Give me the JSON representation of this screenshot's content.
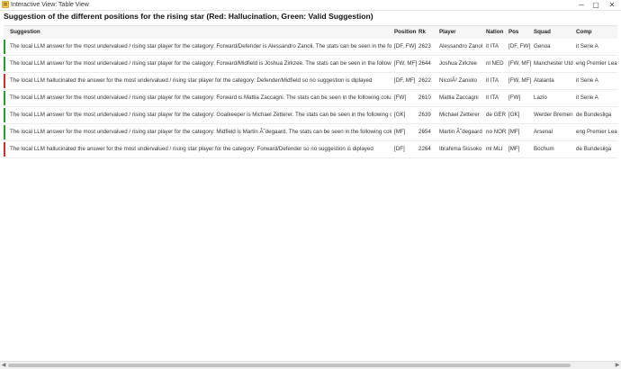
{
  "window": {
    "title": "Interactive View: Table View",
    "controls": {
      "minimize": "─",
      "maximize": "▢",
      "close": "✕"
    }
  },
  "heading": "Suggestion of the different positions for the rising star (Red: Hallucination, Green: Valid Suggestion)",
  "colors": {
    "valid": "#2a9d2a",
    "hallucination": "#d32f2f",
    "header_bg": "#f6f6f6"
  },
  "table": {
    "columns": [
      "Suggestion",
      "Position",
      "Rk",
      "Player",
      "Nation",
      "Pos",
      "Squad",
      "Comp"
    ],
    "rows": [
      {
        "status": "valid",
        "suggestion": "The local LLM answer for the most undervalued / rising star player for the category: Forward/Defender is Alessandro Zanoli. The stats can be seen in the following",
        "position": "[DF, FW]",
        "rk": "2623",
        "player": "Alessandro Zanoli",
        "nation": "it ITA",
        "pos": "[DF, FW]",
        "squad": "Genoa",
        "comp": "it Serie A"
      },
      {
        "status": "valid",
        "suggestion": "The local LLM answer for the most undervalued / rising star player for the category: Forward/Midfield is Joshua Zirkzee. The stats can be seen in the following co",
        "position": "[FW, MF]",
        "rk": "2644",
        "player": "Joshua Zirkzee",
        "nation": "nl NED",
        "pos": "[FW, MF]",
        "squad": "Manchester Utd",
        "comp": "eng Premier League"
      },
      {
        "status": "hallucination",
        "suggestion": "The local LLM hallucinated the answer for the most undervalued / rising star player for the category: Defender/Midfield so no suggestion is diplayed",
        "position": "[DF, MF]",
        "rk": "2622",
        "player": "NicolÃ² Zaniolo",
        "nation": "it ITA",
        "pos": "[FW, MF]",
        "squad": "Atalanta",
        "comp": "it Serie A"
      },
      {
        "status": "valid",
        "suggestion": "The local LLM answer for the most undervalued / rising star player for the category: Forward is Mattia Zaccagni. The stats can be seen in the following columns",
        "position": "[FW]",
        "rk": "2610",
        "player": "Mattia Zaccagni",
        "nation": "it ITA",
        "pos": "[FW]",
        "squad": "Lazio",
        "comp": "it Serie A"
      },
      {
        "status": "valid",
        "suggestion": "The local LLM answer for the most undervalued / rising star player for the category: Goalkeeper is Michael Zetterer. The stats can be seen in the following columns",
        "position": "[GK]",
        "rk": "2639",
        "player": "Michael Zetterer",
        "nation": "de GER",
        "pos": "[GK]",
        "squad": "Werder Bremen",
        "comp": "de Bundesliga"
      },
      {
        "status": "valid",
        "suggestion": "The local LLM answer for the most undervalued / rising star player for the category: Midfield is Martin Ã˜degaard. The stats can be seen in the following colum",
        "position": "[MF]",
        "rk": "2654",
        "player": "Martin Ã˜degaard",
        "nation": "no NOR",
        "pos": "[MF]",
        "squad": "Arsenal",
        "comp": "eng Premier League"
      },
      {
        "status": "hallucination",
        "suggestion": "The local LLM hallucinated the answer for the most undervalued / rising star player for the category: Forward/Defender so no suggestion is diplayed",
        "position": "[DF]",
        "rk": "2264",
        "player": "Ibrahima Sissoko",
        "nation": "ml MLI",
        "pos": "[MF]",
        "squad": "Bochum",
        "comp": "de Bundesliga"
      }
    ]
  },
  "scrollbar": {
    "left_arrow": "◀",
    "right_arrow": "▶"
  }
}
